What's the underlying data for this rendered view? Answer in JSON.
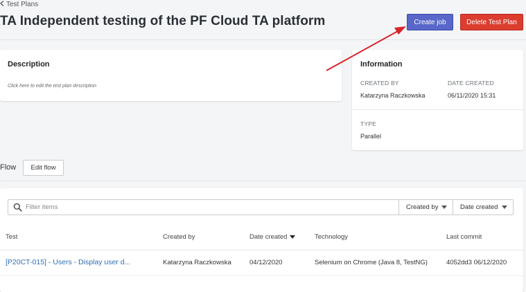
{
  "breadcrumb": {
    "back_label": "Test Plans"
  },
  "header": {
    "title": "TA Independent testing of the PF Cloud TA platform",
    "create_job_label": "Create job",
    "delete_label": "Delete Test Plan"
  },
  "description": {
    "title": "Description",
    "hint": "Click here to edit the test plan description"
  },
  "information": {
    "title": "Information",
    "created_by_label": "CREATED BY",
    "created_by_value": "Katarzyna Raczkowska",
    "date_created_label": "DATE CREATED",
    "date_created_value": "06/11/2020 15:31",
    "type_label": "TYPE",
    "type_value": "Parallel"
  },
  "flow": {
    "label": "Flow",
    "edit_label": "Edit flow"
  },
  "filters": {
    "search_placeholder": "Filter items",
    "created_by_label": "Created by",
    "date_created_label": "Date created"
  },
  "table": {
    "columns": [
      "Test",
      "Created by",
      "Date created",
      "Technology",
      "Last commit"
    ],
    "rows": [
      {
        "test": "[P20CT-015] - Users - Display user d...",
        "created_by": "Katarzyna Raczkowska",
        "date_created": "04/12/2020",
        "technology": "Selenium on Chrome (Java 8, TestNG)",
        "last_commit": "4052dd3 06/12/2020"
      }
    ]
  },
  "colors": {
    "create_job": "#5867c9",
    "delete": "#dc3d2e",
    "link": "#2f6db5",
    "annotation_arrow": "#d9242a"
  },
  "icons": [
    "chevron-left-icon",
    "search-icon",
    "chevron-down-icon",
    "sort-desc-icon"
  ]
}
